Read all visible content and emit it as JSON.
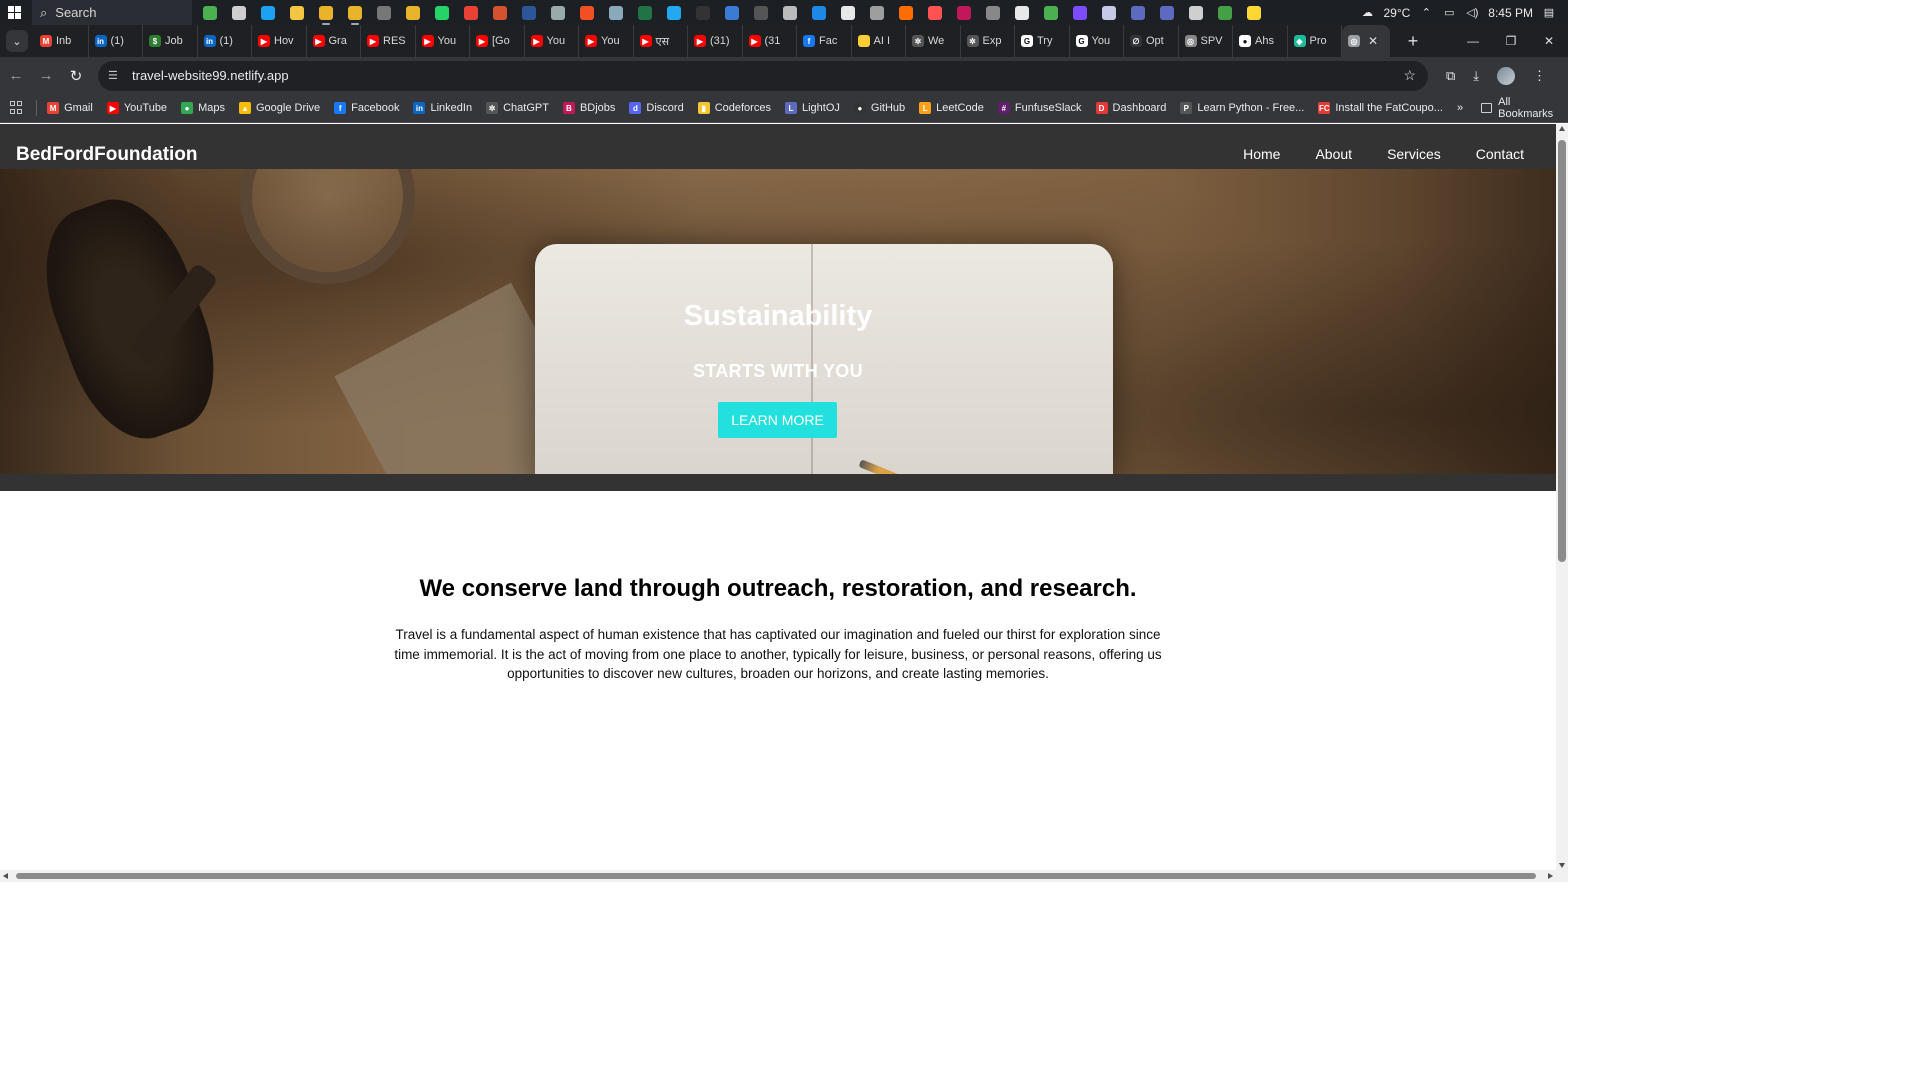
{
  "taskbar": {
    "search_label": "Search",
    "weather": "29°C",
    "time": "8:45 PM",
    "apps": [
      {
        "icon": "widgets-icon",
        "color": "#4caf50"
      },
      {
        "icon": "task-view-icon",
        "color": "#cfcfcf"
      },
      {
        "icon": "edge-icon",
        "color": "#1da1f2"
      },
      {
        "icon": "file-explorer-icon",
        "color": "#f4c542"
      },
      {
        "icon": "chrome-icon",
        "color": "#e9b32a"
      },
      {
        "icon": "chrome-icon",
        "color": "#e9b32a"
      },
      {
        "icon": "app-icon",
        "color": "#777777"
      },
      {
        "icon": "chrome-icon",
        "color": "#e9b32a"
      },
      {
        "icon": "whatsapp-icon",
        "color": "#25d366"
      },
      {
        "icon": "chrome-icon",
        "color": "#e94235"
      },
      {
        "icon": "powerpoint-icon",
        "color": "#d35230"
      },
      {
        "icon": "word-icon",
        "color": "#2b579a"
      },
      {
        "icon": "app-icon",
        "color": "#9aa"
      },
      {
        "icon": "store-icon",
        "color": "#f25022"
      },
      {
        "icon": "app-icon",
        "color": "#8ab"
      },
      {
        "icon": "excel-icon",
        "color": "#217346"
      },
      {
        "icon": "vscode-icon",
        "color": "#23a9f2"
      },
      {
        "icon": "app-icon",
        "color": "#333"
      },
      {
        "icon": "terminal-icon",
        "color": "#3a7bd5"
      },
      {
        "icon": "app-icon",
        "color": "#555"
      },
      {
        "icon": "app-icon",
        "color": "#bbb"
      },
      {
        "icon": "app-icon",
        "color": "#1e88e5"
      },
      {
        "icon": "app-icon",
        "color": "#e8e8e8"
      },
      {
        "icon": "app-icon",
        "color": "#9e9e9e"
      },
      {
        "icon": "app-icon",
        "color": "#ff6d00"
      },
      {
        "icon": "app-icon",
        "color": "#ff5252"
      },
      {
        "icon": "app-icon",
        "color": "#c2185b"
      },
      {
        "icon": "app-icon",
        "color": "#888"
      },
      {
        "icon": "app-icon",
        "color": "#e8e8e8"
      },
      {
        "icon": "app-icon",
        "color": "#4caf50"
      },
      {
        "icon": "app-icon",
        "color": "#7c4dff"
      },
      {
        "icon": "app-icon",
        "color": "#c5cae9"
      },
      {
        "icon": "app-icon",
        "color": "#5c6bc0"
      },
      {
        "icon": "app-icon",
        "color": "#5c6bc0"
      },
      {
        "icon": "app-icon",
        "color": "#cfcfcf"
      },
      {
        "icon": "app-icon",
        "color": "#43a047"
      },
      {
        "icon": "app-icon",
        "color": "#fdd835"
      }
    ]
  },
  "browser": {
    "tabs": [
      {
        "label": "Inb",
        "icon": "gmail-icon",
        "color": "#ea4335",
        "glyph": "M"
      },
      {
        "label": "(1)",
        "icon": "linkedin-icon",
        "color": "#0a66c2",
        "glyph": "in"
      },
      {
        "label": "Job",
        "icon": "job-icon",
        "color": "#2e7d32",
        "glyph": "$"
      },
      {
        "label": "(1)",
        "icon": "linkedin-icon",
        "color": "#0a66c2",
        "glyph": "in"
      },
      {
        "label": "Hov",
        "icon": "youtube-icon",
        "color": "#ff0000",
        "glyph": "▶"
      },
      {
        "label": "Gra",
        "icon": "youtube-icon",
        "color": "#ff0000",
        "glyph": "▶"
      },
      {
        "label": "RES",
        "icon": "youtube-icon",
        "color": "#ff0000",
        "glyph": "▶"
      },
      {
        "label": "You",
        "icon": "youtube-icon",
        "color": "#ff0000",
        "glyph": "▶"
      },
      {
        "label": "[Go",
        "icon": "youtube-icon",
        "color": "#ff0000",
        "glyph": "▶"
      },
      {
        "label": "You",
        "icon": "youtube-icon",
        "color": "#ff0000",
        "glyph": "▶"
      },
      {
        "label": "You",
        "icon": "youtube-icon",
        "color": "#ff0000",
        "glyph": "▶"
      },
      {
        "label": "एस",
        "icon": "youtube-icon",
        "color": "#ff0000",
        "glyph": "▶"
      },
      {
        "label": "(31)",
        "icon": "youtube-icon",
        "color": "#ff0000",
        "glyph": "▶"
      },
      {
        "label": "(31",
        "icon": "youtube-icon",
        "color": "#ff0000",
        "glyph": "▶"
      },
      {
        "label": "Fac",
        "icon": "facebook-icon",
        "color": "#1877f2",
        "glyph": "f"
      },
      {
        "label": "AI I",
        "icon": "dot-icon",
        "color": "#f9ce34",
        "glyph": ""
      },
      {
        "label": "We",
        "icon": "openai-icon",
        "color": "#555555",
        "glyph": "✲"
      },
      {
        "label": "Exp",
        "icon": "openai-icon",
        "color": "#555555",
        "glyph": "✲"
      },
      {
        "label": "Try",
        "icon": "grammarly-icon",
        "color": "#ffffff",
        "glyph": "G"
      },
      {
        "label": "You",
        "icon": "grammarly-icon",
        "color": "#ffffff",
        "glyph": "G"
      },
      {
        "label": "Opt",
        "icon": "optimize-icon",
        "color": "#333333",
        "glyph": "∅"
      },
      {
        "label": "SPV",
        "icon": "globe-icon",
        "color": "#888888",
        "glyph": "◎"
      },
      {
        "label": "Ahs",
        "icon": "github-icon",
        "color": "#ffffff",
        "glyph": "●"
      },
      {
        "label": "Pro",
        "icon": "project-icon",
        "color": "#1abc9c",
        "glyph": "◆"
      }
    ],
    "active_tab_icon": "globe-icon",
    "new_tab_label": "+",
    "url": "travel-website99.netlify.app"
  },
  "bookmarks": [
    {
      "label": "Gmail",
      "icon": "gmail-icon",
      "color": "#ea4335",
      "glyph": "M"
    },
    {
      "label": "YouTube",
      "icon": "youtube-icon",
      "color": "#ff0000",
      "glyph": "▶"
    },
    {
      "label": "Maps",
      "icon": "maps-icon",
      "color": "#34a853",
      "glyph": "●"
    },
    {
      "label": "Google Drive",
      "icon": "drive-icon",
      "color": "#fbbc04",
      "glyph": "▲"
    },
    {
      "label": "Facebook",
      "icon": "facebook-icon",
      "color": "#1877f2",
      "glyph": "f"
    },
    {
      "label": "LinkedIn",
      "icon": "linkedin-icon",
      "color": "#0a66c2",
      "glyph": "in"
    },
    {
      "label": "ChatGPT",
      "icon": "openai-icon",
      "color": "#555555",
      "glyph": "✲"
    },
    {
      "label": "BDjobs",
      "icon": "bdjobs-icon",
      "color": "#c2185b",
      "glyph": "B"
    },
    {
      "label": "Discord",
      "icon": "discord-icon",
      "color": "#5865f2",
      "glyph": "d"
    },
    {
      "label": "Codeforces",
      "icon": "codeforces-icon",
      "color": "#f7c531",
      "glyph": "▮"
    },
    {
      "label": "LightOJ",
      "icon": "lightoj-icon",
      "color": "#5c6bc0",
      "glyph": "L"
    },
    {
      "label": "GitHub",
      "icon": "github-icon",
      "color": "#333333",
      "glyph": "●"
    },
    {
      "label": "LeetCode",
      "icon": "leetcode-icon",
      "color": "#ffa116",
      "glyph": "L"
    },
    {
      "label": "FunfuseSlack",
      "icon": "slack-icon",
      "color": "#611f69",
      "glyph": "#"
    },
    {
      "label": "Dashboard",
      "icon": "dashboard-icon",
      "color": "#e53935",
      "glyph": "D"
    },
    {
      "label": "Learn Python - Free...",
      "icon": "python-icon",
      "color": "#555555",
      "glyph": "P"
    },
    {
      "label": "Install the FatCoupo...",
      "icon": "fatcoupon-icon",
      "color": "#e53935",
      "glyph": "FC"
    }
  ],
  "bookmarks_all_label": "All Bookmarks",
  "site": {
    "brand": "BedFordFoundation",
    "nav": [
      "Home",
      "About",
      "Services",
      "Contact"
    ],
    "hero": {
      "title": "Sustainability",
      "subtitle": "STARTS WITH YOU",
      "button": "LEARN MORE",
      "button_color": "#22e0de"
    },
    "about": {
      "heading": "We conserve land through outreach, restoration, and research.",
      "body": "Travel is a fundamental aspect of human existence that has captivated our imagination and fueled our thirst for exploration since time immemorial. It is the act of moving from one place to another, typically for leisure, business, or personal reasons, offering us opportunities to discover new cultures, broaden our horizons, and create lasting memories."
    }
  }
}
